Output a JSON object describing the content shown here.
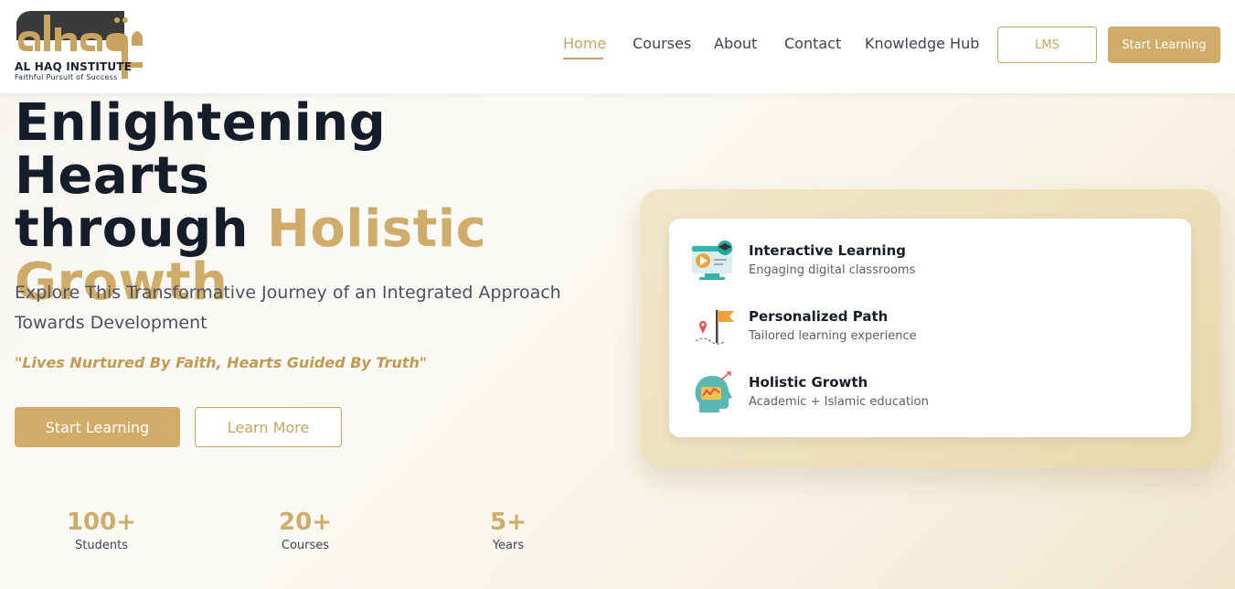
{
  "brand": {
    "mark": "alhaq",
    "name": "AL HAQ INSTITUTE",
    "tagline": "Faithful Pursuit of Success"
  },
  "nav": {
    "items": [
      "Home",
      "Courses",
      "About",
      "Contact",
      "Knowledge Hub"
    ],
    "active": "Home",
    "lms_label": "LMS",
    "start_label": "Start Learning"
  },
  "hero": {
    "title_line1": "Enlightening Hearts",
    "title_line2_plain": "through ",
    "title_line2_accent": "Holistic",
    "title_line3_accent": "Growth",
    "subtitle": "Explore This Transformative Journey of an Integrated Approach Towards Development",
    "quote": "\"Lives Nurtured By Faith, Hearts Guided By Truth\"",
    "primary_button": "Start Learning",
    "secondary_button": "Learn More"
  },
  "stats": [
    {
      "value": "100+",
      "label": "Students"
    },
    {
      "value": "20+",
      "label": "Courses"
    },
    {
      "value": "5+",
      "label": "Years"
    }
  ],
  "features": [
    {
      "title": "Interactive Learning",
      "desc": "Engaging digital classrooms",
      "icon": "interactive-learning-icon"
    },
    {
      "title": "Personalized Path",
      "desc": "Tailored learning experience",
      "icon": "personalized-path-icon"
    },
    {
      "title": "Holistic Growth",
      "desc": "Academic + Islamic education",
      "icon": "holistic-growth-icon"
    }
  ],
  "colors": {
    "accent": "#d1ac68",
    "heading": "#151d2b",
    "text": "#4a5160"
  }
}
